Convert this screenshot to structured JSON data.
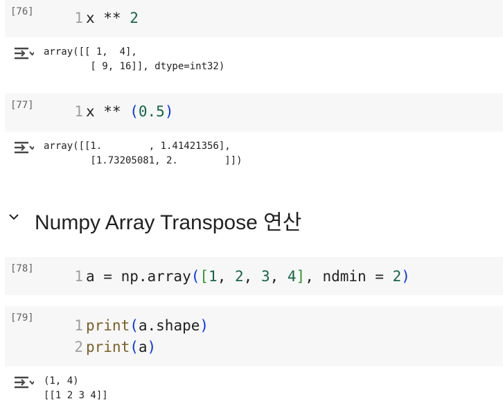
{
  "cells": [
    {
      "count": "[76]",
      "lines": [
        {
          "num": "1",
          "segments": [
            {
              "t": "x ** ",
              "c": ""
            },
            {
              "t": "2",
              "c": "num"
            }
          ]
        }
      ],
      "output": "array([[ 1,  4],\n        [ 9, 16]], dtype=int32)"
    },
    {
      "count": "[77]",
      "lines": [
        {
          "num": "1",
          "segments": [
            {
              "t": "x ** ",
              "c": ""
            },
            {
              "t": "(",
              "c": "paren"
            },
            {
              "t": "0.5",
              "c": "num"
            },
            {
              "t": ")",
              "c": "paren"
            }
          ]
        }
      ],
      "output": "array([[1.        , 1.41421356],\n        [1.73205081, 2.        ]])"
    },
    {
      "count": "[78]",
      "lines": [
        {
          "num": "1",
          "segments": [
            {
              "t": "a = np.array",
              "c": ""
            },
            {
              "t": "(",
              "c": "paren"
            },
            {
              "t": "[",
              "c": "bracket"
            },
            {
              "t": "1",
              "c": "num"
            },
            {
              "t": ", ",
              "c": ""
            },
            {
              "t": "2",
              "c": "num"
            },
            {
              "t": ", ",
              "c": ""
            },
            {
              "t": "3",
              "c": "num"
            },
            {
              "t": ", ",
              "c": ""
            },
            {
              "t": "4",
              "c": "num"
            },
            {
              "t": "]",
              "c": "bracket"
            },
            {
              "t": ", ndmin = ",
              "c": ""
            },
            {
              "t": "2",
              "c": "num"
            },
            {
              "t": ")",
              "c": "paren"
            }
          ]
        }
      ],
      "output": ""
    },
    {
      "count": "[79]",
      "lines": [
        {
          "num": "1",
          "segments": [
            {
              "t": "print",
              "c": "fn"
            },
            {
              "t": "(",
              "c": "paren"
            },
            {
              "t": "a.shape",
              "c": ""
            },
            {
              "t": ")",
              "c": "paren"
            }
          ]
        },
        {
          "num": "2",
          "segments": [
            {
              "t": "print",
              "c": "fn"
            },
            {
              "t": "(",
              "c": "paren"
            },
            {
              "t": "a",
              "c": ""
            },
            {
              "t": ")",
              "c": "paren"
            }
          ]
        }
      ],
      "output": "(1, 4)\n[[1 2 3 4]]"
    }
  ],
  "section": {
    "heading": "Numpy Array Transpose 연산",
    "icon": "chevron-down-icon"
  },
  "colors": {
    "cell_bg": "#f7f7f7",
    "number": "#116644",
    "paren": "#0431fa",
    "bracket": "#319331",
    "function": "#795e26"
  }
}
